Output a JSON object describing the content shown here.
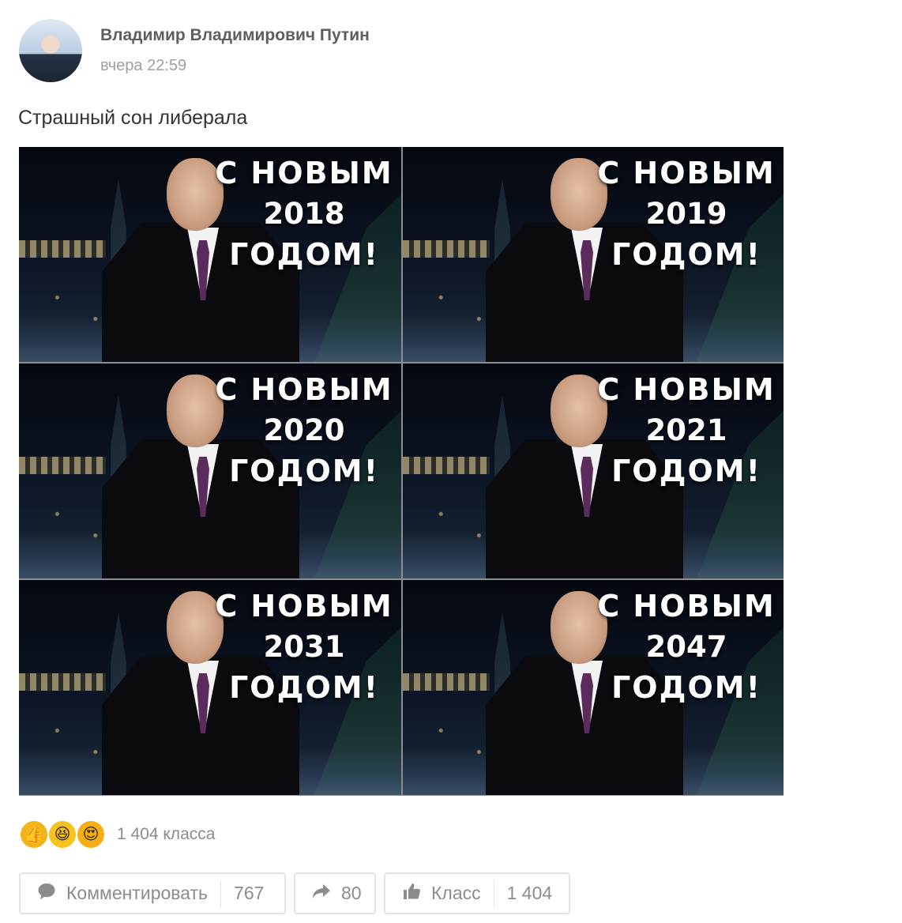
{
  "post": {
    "author": "Владимир Владимирович Путин",
    "time": "вчера 22:59",
    "text": "Страшный сон либерала"
  },
  "image_tiles": [
    {
      "line1": "С НОВЫМ",
      "year": "2018",
      "line3": "ГОДОМ!"
    },
    {
      "line1": "С НОВЫМ",
      "year": "2019",
      "line3": "ГОДОМ!"
    },
    {
      "line1": "С НОВЫМ",
      "year": "2020",
      "line3": "ГОДОМ!"
    },
    {
      "line1": "С НОВЫМ",
      "year": "2021",
      "line3": "ГОДОМ!"
    },
    {
      "line1": "С НОВЫМ",
      "year": "2031",
      "line3": "ГОДОМ!"
    },
    {
      "line1": "С НОВЫМ",
      "year": "2047",
      "line3": "ГОДОМ!"
    }
  ],
  "reactions": {
    "icons": [
      "thumbs-up",
      "laughing-face",
      "heart-eyes-face"
    ],
    "count_text": "1 404 класса"
  },
  "actions": {
    "comment_label": "Комментировать",
    "comment_count": "767",
    "share_count": "80",
    "like_label": "Класс",
    "like_count": "1 404"
  },
  "colors": {
    "accent_gold": "#f4b31a",
    "muted_text": "#8c8c8c",
    "author_text": "#5e5e5e"
  }
}
